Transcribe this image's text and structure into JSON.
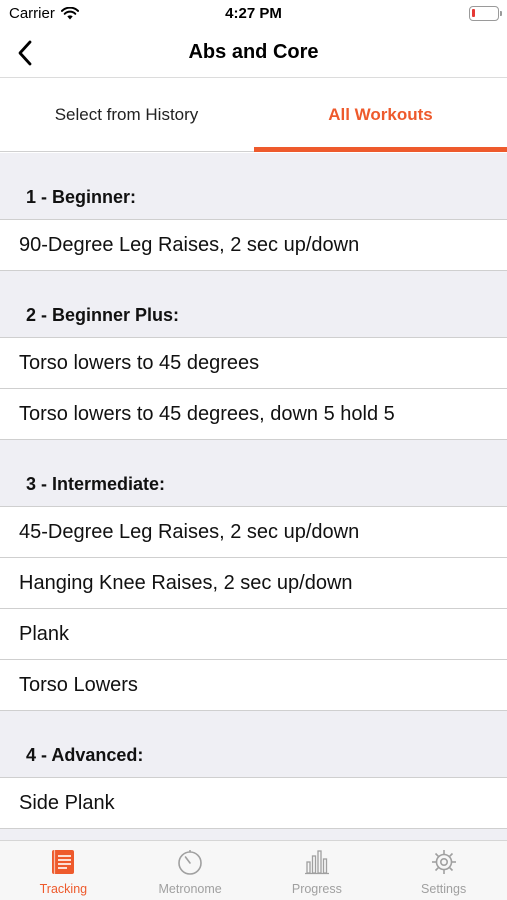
{
  "status_bar": {
    "carrier": "Carrier",
    "time": "4:27 PM",
    "battery_level": 0.12,
    "battery_color": "#e53935"
  },
  "nav": {
    "title": "Abs and Core",
    "back_icon": "chevron-left-icon"
  },
  "segment": {
    "tabs": [
      {
        "label": "Select from History",
        "selected": false
      },
      {
        "label": "All Workouts",
        "selected": true
      }
    ]
  },
  "accent_color": "#ee5a2c",
  "sections": [
    {
      "title": "1 - Beginner:",
      "items": [
        "90-Degree Leg Raises, 2 sec up/down"
      ]
    },
    {
      "title": "2 - Beginner Plus:",
      "items": [
        "Torso lowers to 45 degrees",
        "Torso lowers to 45 degrees, down 5 hold 5"
      ]
    },
    {
      "title": "3 - Intermediate:",
      "items": [
        "45-Degree Leg Raises, 2 sec up/down",
        "Hanging Knee Raises, 2 sec up/down",
        "Plank",
        "Torso Lowers"
      ]
    },
    {
      "title": "4 - Advanced:",
      "items": [
        "Side Plank"
      ]
    }
  ],
  "tab_bar": {
    "tabs": [
      {
        "label": "Tracking",
        "icon": "clipboard-icon",
        "active": true
      },
      {
        "label": "Metronome",
        "icon": "stopwatch-icon",
        "active": false
      },
      {
        "label": "Progress",
        "icon": "bar-chart-icon",
        "active": false
      },
      {
        "label": "Settings",
        "icon": "gear-icon",
        "active": false
      }
    ]
  }
}
